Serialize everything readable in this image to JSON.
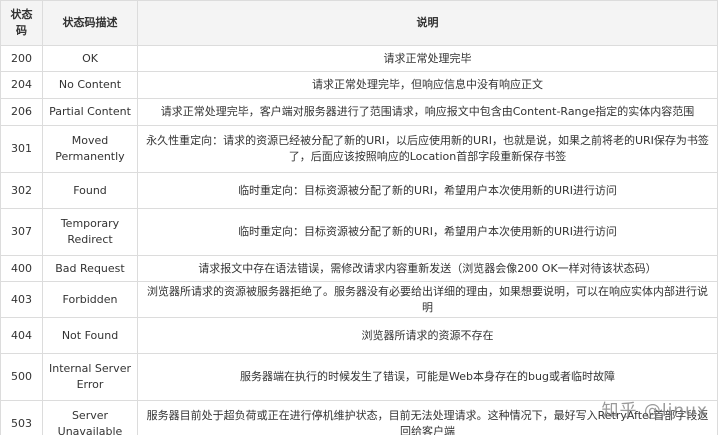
{
  "table": {
    "headers": {
      "code": "状态码",
      "desc": "状态码描述",
      "expl": "说明"
    },
    "rows": [
      {
        "code": "200",
        "desc": "OK",
        "expl": "请求正常处理完毕"
      },
      {
        "code": "204",
        "desc": "No Content",
        "expl": "请求正常处理完毕，但响应信息中没有响应正文"
      },
      {
        "code": "206",
        "desc": "Partial Content",
        "expl": "请求正常处理完毕，客户端对服务器进行了范围请求，响应报文中包含由Content-Range指定的实体内容范围"
      },
      {
        "code": "301",
        "desc": "Moved Permanently",
        "expl": "永久性重定向：请求的资源已经被分配了新的URI，以后应使用新的URI，也就是说，如果之前将老的URI保存为书签了，后面应该按照响应的Location首部字段重新保存书签"
      },
      {
        "code": "302",
        "desc": "Found",
        "expl": "临时重定向：目标资源被分配了新的URI，希望用户本次使用新的URI进行访问"
      },
      {
        "code": "307",
        "desc": "Temporary Redirect",
        "expl": "临时重定向：目标资源被分配了新的URI，希望用户本次使用新的URI进行访问"
      },
      {
        "code": "400",
        "desc": "Bad Request",
        "expl": "请求报文中存在语法错误，需修改请求内容重新发送（浏览器会像200 OK一样对待该状态码）"
      },
      {
        "code": "403",
        "desc": "Forbidden",
        "expl": "浏览器所请求的资源被服务器拒绝了。服务器没有必要给出详细的理由，如果想要说明，可以在响应实体内部进行说明"
      },
      {
        "code": "404",
        "desc": "Not Found",
        "expl": "浏览器所请求的资源不存在"
      },
      {
        "code": "500",
        "desc": "Internal Server Error",
        "expl": "服务器端在执行的时候发生了错误，可能是Web本身存在的bug或者临时故障"
      },
      {
        "code": "503",
        "desc": "Server Unavailable",
        "expl": "服务器目前处于超负荷或正在进行停机维护状态，目前无法处理请求。这种情况下，最好写入RetryAfter首部字段返回给客户端"
      }
    ]
  },
  "watermark": "知乎 @linux"
}
